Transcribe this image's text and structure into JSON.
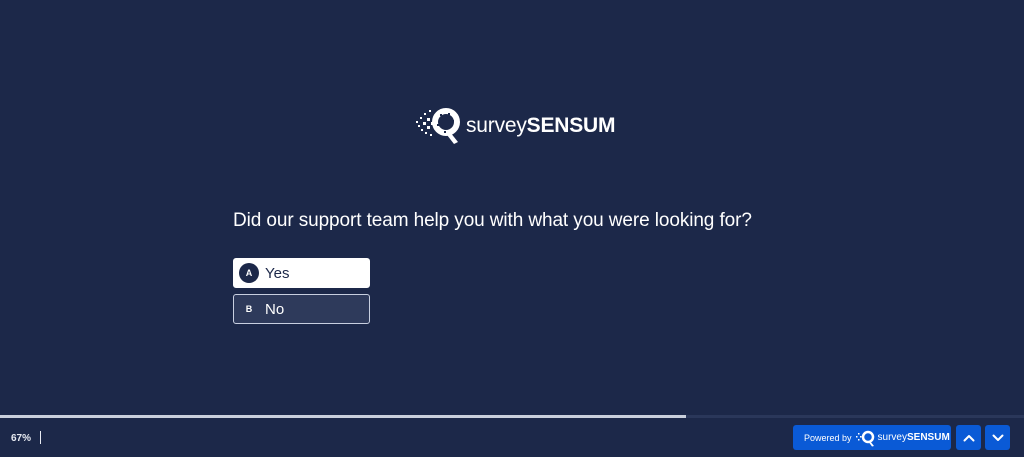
{
  "logo": {
    "text_light": "survey",
    "text_bold": "SENSUM"
  },
  "question": {
    "text": "Did our support team help you with what you were looking for?"
  },
  "options": [
    {
      "key": "A",
      "label": "Yes",
      "selected": true
    },
    {
      "key": "B",
      "label": "No",
      "selected": false
    }
  ],
  "progress": {
    "percent": 67,
    "label": "67%"
  },
  "footer": {
    "powered_by": "Powered by",
    "brand_light": "survey",
    "brand_bold": "SENSUM"
  },
  "icons": {
    "up": "chevron-up-icon",
    "down": "chevron-down-icon",
    "logo": "surveysensum-logo-icon"
  },
  "colors": {
    "background": "#1c2849",
    "accent": "#0a5ad6",
    "text": "#ffffff"
  }
}
